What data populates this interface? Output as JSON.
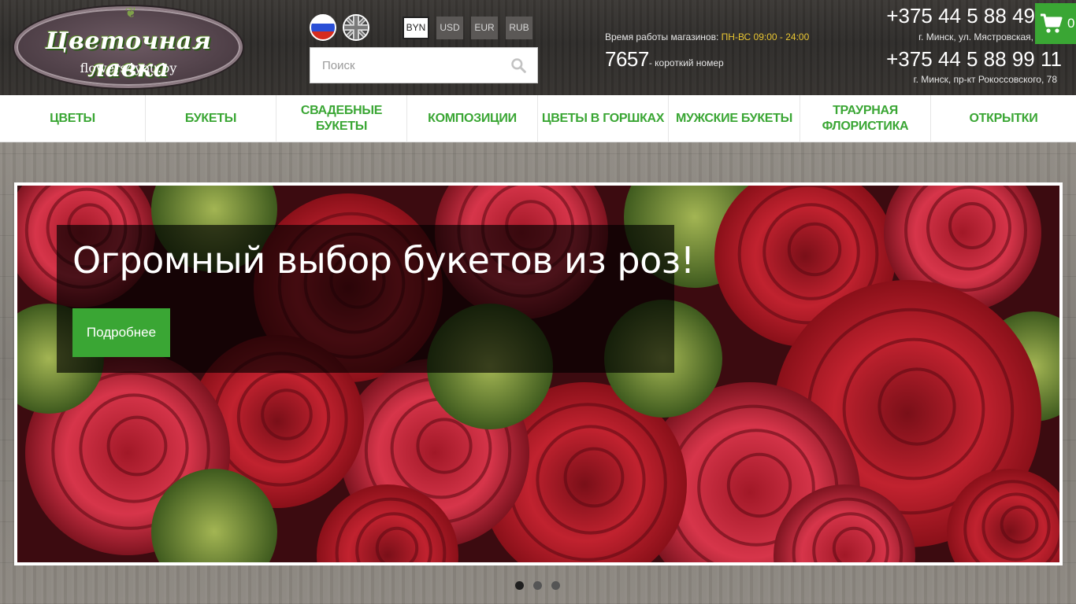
{
  "logo": {
    "title": "Цветочная лавка",
    "subtitle": "flowers4you.by"
  },
  "languages": [
    {
      "name": "ru-flag-icon"
    },
    {
      "name": "uk-flag-icon"
    }
  ],
  "currencies": [
    "BYN",
    "USD",
    "EUR",
    "RUB"
  ],
  "active_currency": "BYN",
  "search": {
    "placeholder": "Поиск"
  },
  "hours": {
    "label": "Время работы магазинов:",
    "value": "ПН-ВС 09:00 - 24:00"
  },
  "short_number": {
    "number": "7657",
    "label": "- короткий номер"
  },
  "contacts": [
    {
      "phone": "+375 44 5 88 49",
      "address": "г. Минск, ул. Мястровская,"
    },
    {
      "phone": "+375 44 5 88 99 11",
      "address": "г. Минск, пр-кт Рокоссовского, 78"
    }
  ],
  "cart": {
    "count": "0",
    "icon": "cart-icon"
  },
  "nav": [
    "ЦВЕТЫ",
    "БУКЕТЫ",
    "СВАДЕБНЫЕ БУКЕТЫ",
    "КОМПОЗИЦИИ",
    "ЦВЕТЫ В ГОРШКАХ",
    "МУЖСКИЕ БУКЕТЫ",
    "ТРАУРНАЯ ФЛОРИСТИКА",
    "ОТКРЫТКИ"
  ],
  "slider": {
    "title": "Огромный выбор букетов из роз!",
    "button": "Подробнее",
    "slide_count": 3,
    "active_slide": 1
  },
  "colors": {
    "accent_green": "#3aa634",
    "hours_accent": "#e9c632"
  }
}
